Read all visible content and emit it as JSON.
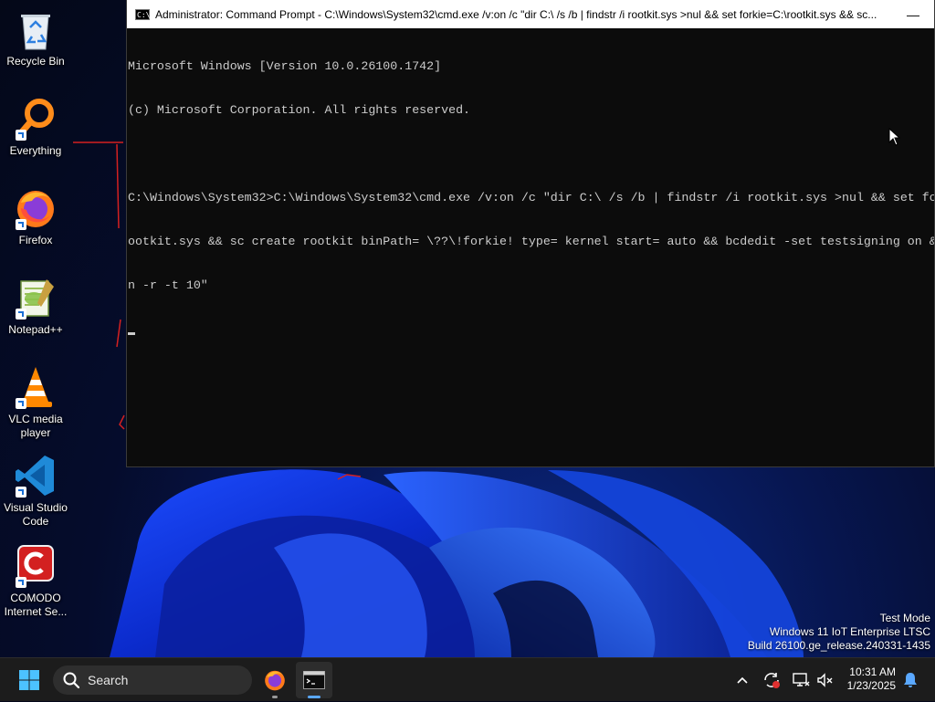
{
  "desktop": {
    "icons": [
      {
        "label": "Recycle Bin",
        "icon": "recycle-bin-icon"
      },
      {
        "label": "Everything",
        "icon": "everything-search-icon"
      },
      {
        "label": "Firefox",
        "icon": "firefox-icon"
      },
      {
        "label": "Notepad++",
        "icon": "notepad-plus-plus-icon"
      },
      {
        "label": "VLC media player",
        "icon": "vlc-icon"
      },
      {
        "label": "Visual Studio Code",
        "icon": "vscode-icon"
      },
      {
        "label": "COMODO Internet Se...",
        "icon": "comodo-icon"
      }
    ],
    "watermark": {
      "line1": "Test Mode",
      "line2": "Windows 11 IoT Enterprise LTSC",
      "line3": "Build 26100.ge_release.240331-1435"
    }
  },
  "cmd_window": {
    "icon_label": "C:\\_",
    "title": "Administrator: Command Prompt - C:\\Windows\\System32\\cmd.exe  /v:on /c \"dir C:\\ /s /b | findstr /i rootkit.sys >nul && set forkie=C:\\rootkit.sys && sc...",
    "minimize_label": "—",
    "lines": [
      "Microsoft Windows [Version 10.0.26100.1742]",
      "(c) Microsoft Corporation. All rights reserved.",
      "",
      "C:\\Windows\\System32>C:\\Windows\\System32\\cmd.exe /v:on /c \"dir C:\\ /s /b | findstr /i rootkit.sys >nul && set fo",
      "ootkit.sys && sc create rootkit binPath= \\??\\!forkie! type= kernel start= auto && bcdedit -set testsigning on &",
      "n -r -t 10\""
    ]
  },
  "taskbar": {
    "search_label": "Search",
    "time": "10:31 AM",
    "date": "1/23/2025",
    "accent": "#5aa8ff"
  }
}
